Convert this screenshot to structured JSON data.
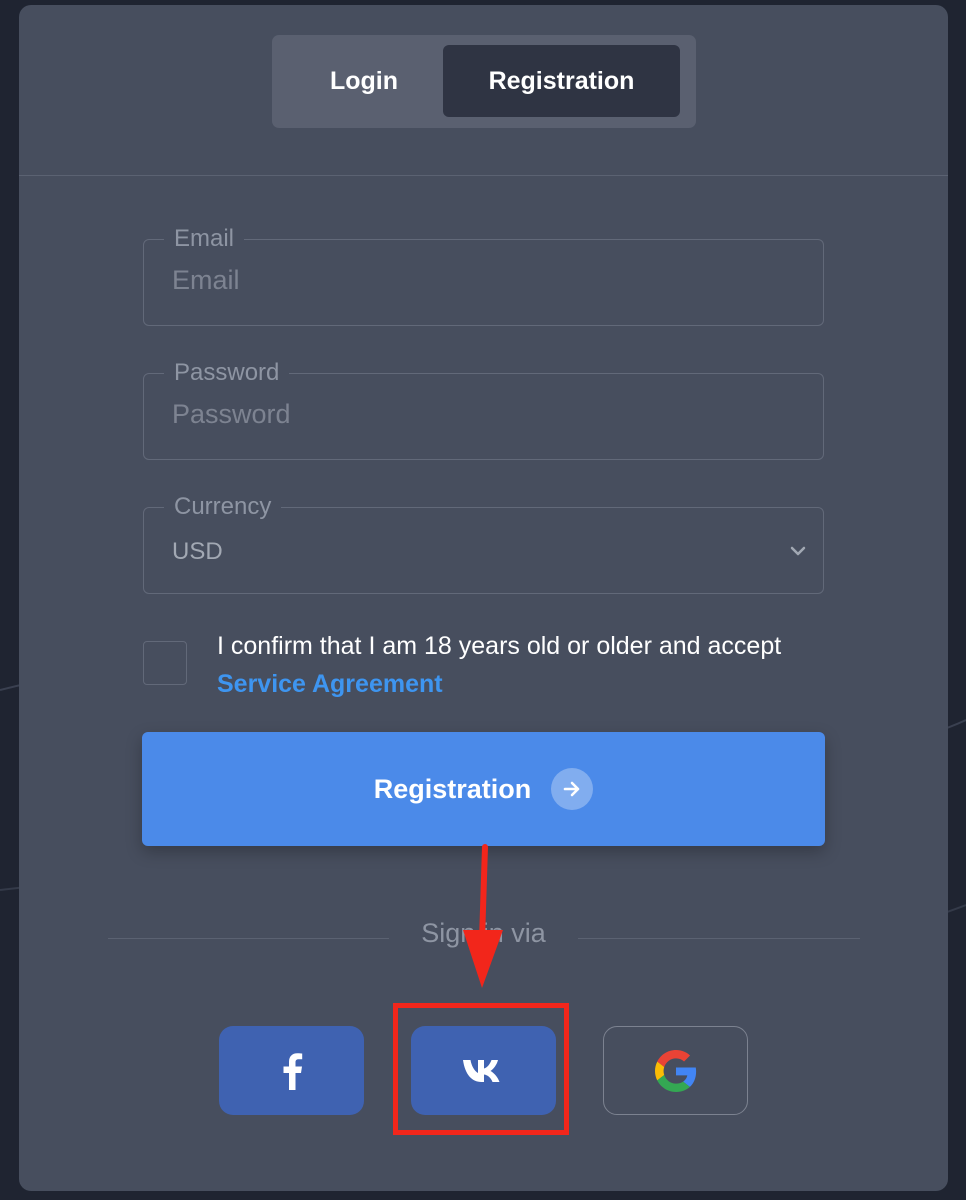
{
  "tabs": {
    "login": "Login",
    "registration": "Registration",
    "active": "Registration"
  },
  "form": {
    "email": {
      "label": "Email",
      "placeholder": "Email"
    },
    "password": {
      "label": "Password",
      "placeholder": "Password"
    },
    "currency": {
      "label": "Currency",
      "value": "USD"
    },
    "consent": {
      "text": "I confirm that I am 18 years old or older and accept",
      "link": "Service Agreement",
      "checked": false
    },
    "submit_label": "Registration"
  },
  "social": {
    "title": "Sign in via",
    "providers": [
      "facebook",
      "vk",
      "google"
    ],
    "highlighted": "vk"
  },
  "colors": {
    "card_bg": "#474e5e",
    "primary": "#4b8ae9",
    "link": "#3e95f0",
    "social_brand": "#3f62b1",
    "annotation": "#f2261b"
  },
  "icons": {
    "submit": "arrow-right-icon",
    "currency": "chevron-down-icon",
    "facebook": "facebook-icon",
    "vk": "vk-icon",
    "google": "google-icon"
  }
}
